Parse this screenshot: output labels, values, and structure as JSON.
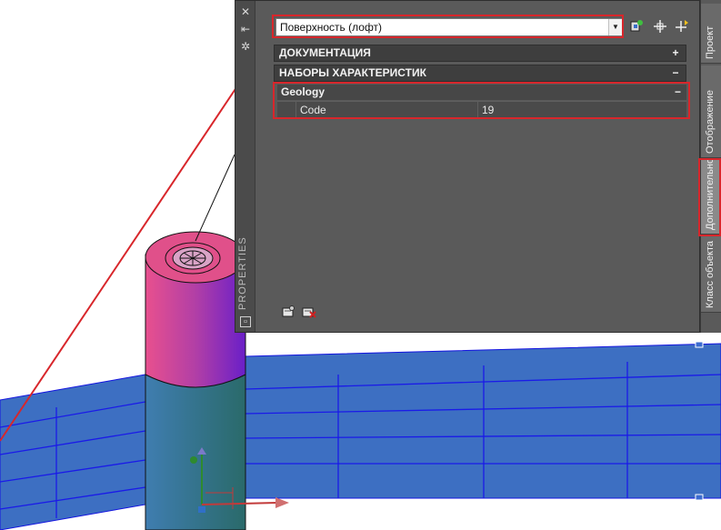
{
  "palette": {
    "title": "PROPERTIES",
    "strip_icons": [
      "close-icon",
      "auto-hide-icon",
      "settings-icon"
    ],
    "selector": {
      "value": "Поверхность (лофт)"
    },
    "toolbar": [
      "add-property-set-icon",
      "pick-object-icon",
      "quick-select-icon"
    ],
    "sections": {
      "documentation": {
        "label": "ДОКУМЕНТАЦИЯ",
        "toggle": "+"
      },
      "property_sets": {
        "label": "НАБОРЫ ХАРАКТЕРИСТИК",
        "toggle": "−"
      }
    },
    "group": {
      "label": "Geology",
      "toggle": "−"
    },
    "property": {
      "name": "Code",
      "value": "19"
    },
    "bottom_icons": [
      "add-property-sets-icon",
      "remove-property-sets-icon"
    ]
  },
  "tabs": [
    {
      "label": "Проект",
      "active": false
    },
    {
      "label": "Отображение",
      "active": false
    },
    {
      "label": "Дополнительно",
      "active": true
    },
    {
      "label": "Класс объекта",
      "active": false
    }
  ],
  "colors": {
    "highlight": "#d8262b",
    "surface": "#3d6fc2",
    "surface_lines": "#1414e0",
    "cylinder_top": "#e0508a",
    "palette_bg": "#5a5a5a"
  }
}
